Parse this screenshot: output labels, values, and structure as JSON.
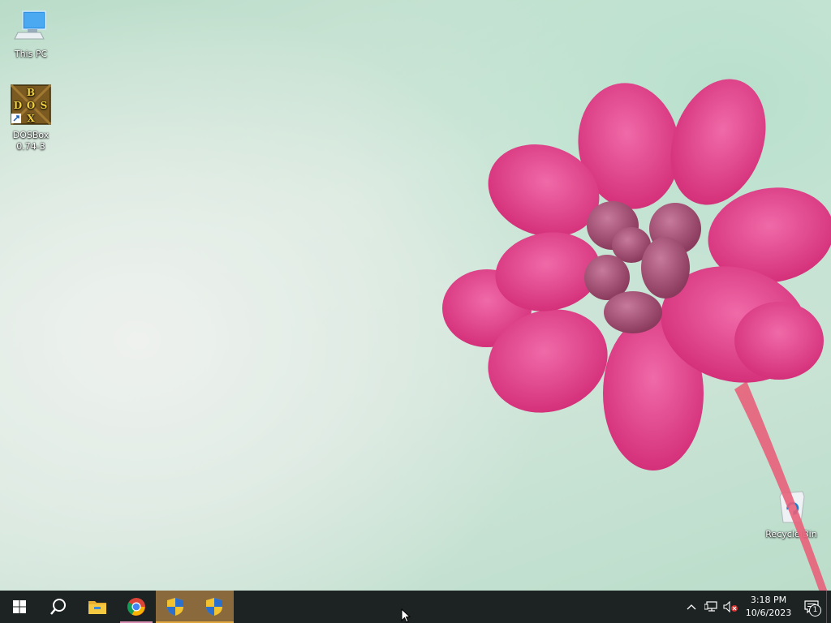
{
  "desktop": {
    "icons": [
      {
        "label": "This PC"
      },
      {
        "label": "DOSBox 0.74-3",
        "line1": "DOSBox",
        "line2": "0.74-3",
        "logo_letters": [
          "B",
          "D",
          "O",
          "S",
          "X"
        ]
      },
      {
        "label": "Recycle Bin"
      }
    ]
  },
  "taskbar": {
    "buttons": [
      {
        "icon": "windows-start-icon"
      },
      {
        "icon": "search-icon"
      },
      {
        "icon": "file-explorer-icon"
      },
      {
        "icon": "chrome-icon"
      },
      {
        "icon": "uac-shield-icon"
      },
      {
        "icon": "uac-shield-icon"
      }
    ],
    "tray": {
      "time": "3:18 PM",
      "date": "10/6/2023",
      "notification_count": "1"
    },
    "active_color": "#8a6a3c",
    "background_color": "#1c2322"
  }
}
